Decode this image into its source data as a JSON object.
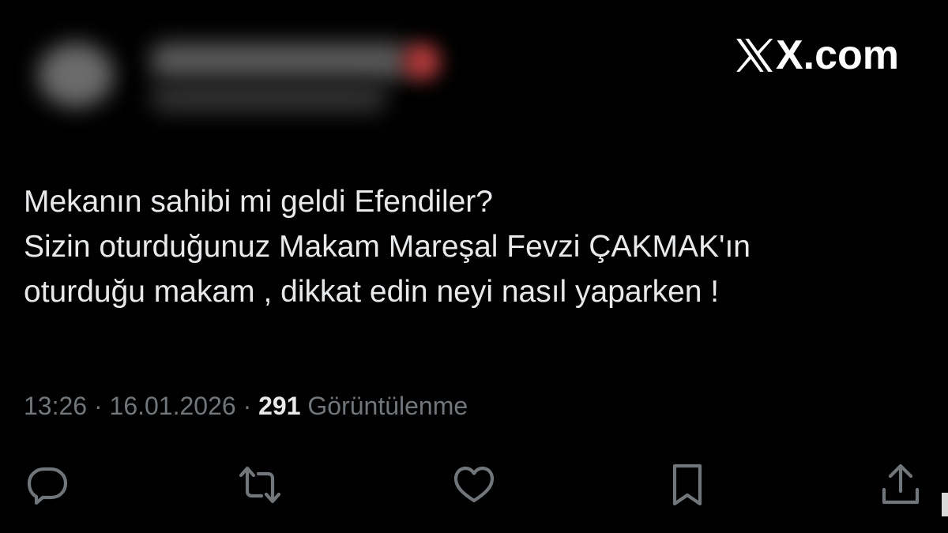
{
  "brand": {
    "name": "X.com"
  },
  "author": {
    "display_name": "",
    "handle": ""
  },
  "tweet": {
    "lines": [
      "Mekanın sahibi mi geldi Efendiler?",
      "Sizin oturduğunuz Makam Mareşal Fevzi ÇAKMAK'ın",
      "oturduğu makam , dikkat edin neyi nasıl yaparken !"
    ]
  },
  "meta": {
    "time": "13:26",
    "separator": "·",
    "date": "16.01.2026",
    "views_count": "291",
    "views_label": "Görüntülenme"
  },
  "actions": [
    {
      "icon": "reply-icon"
    },
    {
      "icon": "retweet-icon"
    },
    {
      "icon": "like-icon"
    },
    {
      "icon": "bookmark-icon"
    },
    {
      "icon": "share-icon"
    }
  ],
  "colors": {
    "background": "#000000",
    "text_primary": "#e7e9ea",
    "text_secondary": "#71767b",
    "brand": "#ffffff"
  }
}
